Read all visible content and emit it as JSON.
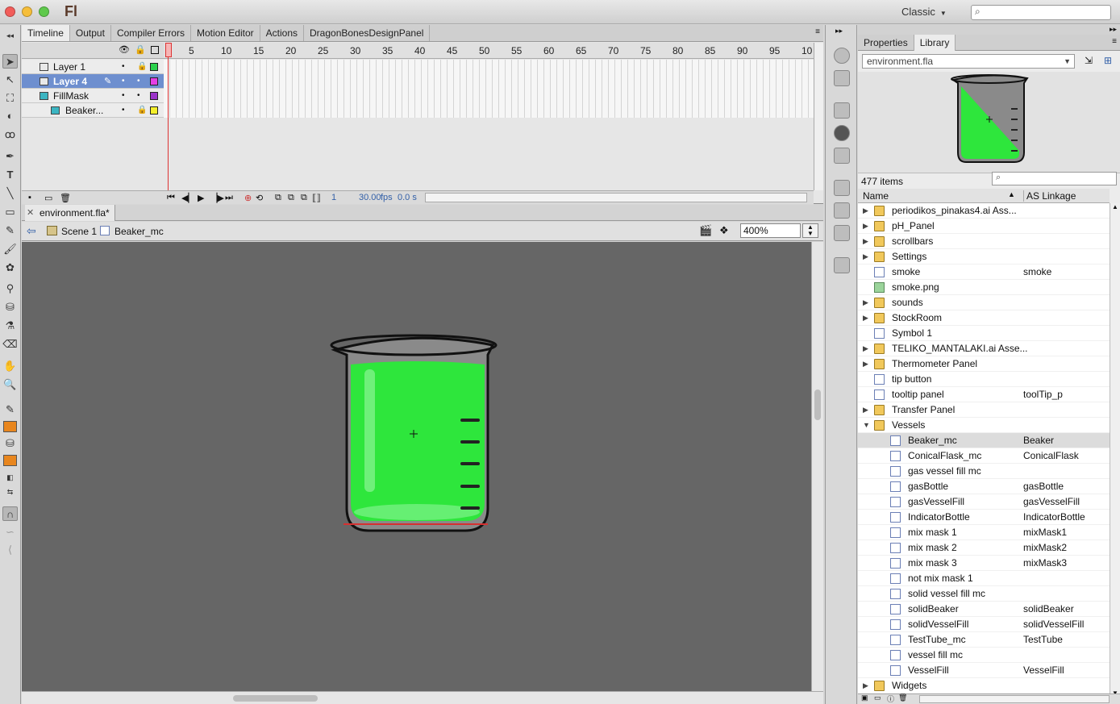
{
  "app": {
    "logo": "Fl",
    "workspace": "Classic"
  },
  "timeline_tabs": [
    "Timeline",
    "Output",
    "Compiler Errors",
    "Motion Editor",
    "Actions",
    "DragonBonesDesignPanel"
  ],
  "layers": [
    {
      "name": "Layer 1",
      "color": "#2bd14c",
      "selected": false,
      "type": "layer"
    },
    {
      "name": "Layer 4",
      "color": "#e43fe5",
      "selected": true,
      "type": "layer"
    },
    {
      "name": "FillMask",
      "color": "#9b33c9",
      "selected": false,
      "type": "mask"
    },
    {
      "name": "Beaker...",
      "color": "#f4ef2b",
      "selected": false,
      "type": "masked"
    }
  ],
  "frame_numbers": [
    "1",
    "5",
    "10",
    "15",
    "20",
    "25",
    "30",
    "35",
    "40",
    "45",
    "50",
    "55",
    "60",
    "65",
    "70",
    "75",
    "80",
    "85",
    "90",
    "95",
    "10"
  ],
  "timeline_footer": {
    "frame": "1",
    "fps": "30.00",
    "fps_unit": "fps",
    "time": "0.0 s"
  },
  "document": {
    "tab": "environment.fla*",
    "scene": "Scene 1",
    "symbol": "Beaker_mc",
    "zoom": "400%"
  },
  "library": {
    "tabs": [
      "Properties",
      "Library"
    ],
    "document": "environment.fla",
    "count": "477 items",
    "columns": {
      "name": "Name",
      "linkage": "AS Linkage"
    },
    "items": [
      {
        "name": "periodikos_pinakas4.ai Ass...",
        "linkage": "",
        "icon": "folder",
        "indent": 0,
        "expand": "closed"
      },
      {
        "name": "pH_Panel",
        "linkage": "",
        "icon": "folder",
        "indent": 0,
        "expand": "closed"
      },
      {
        "name": "scrollbars",
        "linkage": "",
        "icon": "folder",
        "indent": 0,
        "expand": "closed"
      },
      {
        "name": "Settings",
        "linkage": "",
        "icon": "folder",
        "indent": 0,
        "expand": "closed"
      },
      {
        "name": "smoke",
        "linkage": "smoke",
        "icon": "symbol",
        "indent": 0,
        "expand": ""
      },
      {
        "name": "smoke.png",
        "linkage": "",
        "icon": "bitmap",
        "indent": 0,
        "expand": ""
      },
      {
        "name": "sounds",
        "linkage": "",
        "icon": "folder",
        "indent": 0,
        "expand": "closed"
      },
      {
        "name": "StockRoom",
        "linkage": "",
        "icon": "folder",
        "indent": 0,
        "expand": "closed"
      },
      {
        "name": "Symbol 1",
        "linkage": "",
        "icon": "symbol",
        "indent": 0,
        "expand": ""
      },
      {
        "name": "TELIKO_MANTALAKI.ai Asse...",
        "linkage": "",
        "icon": "folder",
        "indent": 0,
        "expand": "closed"
      },
      {
        "name": "Thermometer Panel",
        "linkage": "",
        "icon": "folder",
        "indent": 0,
        "expand": "closed"
      },
      {
        "name": "tip button",
        "linkage": "",
        "icon": "symbol",
        "indent": 0,
        "expand": ""
      },
      {
        "name": "tooltip panel",
        "linkage": "toolTip_p",
        "icon": "symbol",
        "indent": 0,
        "expand": ""
      },
      {
        "name": "Transfer Panel",
        "linkage": "",
        "icon": "folder",
        "indent": 0,
        "expand": "closed"
      },
      {
        "name": "Vessels",
        "linkage": "",
        "icon": "folder",
        "indent": 0,
        "expand": "open"
      },
      {
        "name": "Beaker_mc",
        "linkage": "Beaker",
        "icon": "symbol",
        "indent": 1,
        "expand": "",
        "selected": true
      },
      {
        "name": "ConicalFlask_mc",
        "linkage": "ConicalFlask",
        "icon": "symbol",
        "indent": 1,
        "expand": ""
      },
      {
        "name": "gas vessel fill mc",
        "linkage": "",
        "icon": "symbol",
        "indent": 1,
        "expand": ""
      },
      {
        "name": "gasBottle",
        "linkage": "gasBottle",
        "icon": "symbol",
        "indent": 1,
        "expand": ""
      },
      {
        "name": "gasVesselFill",
        "linkage": "gasVesselFill",
        "icon": "symbol",
        "indent": 1,
        "expand": ""
      },
      {
        "name": "IndicatorBottle",
        "linkage": "IndicatorBottle",
        "icon": "symbol",
        "indent": 1,
        "expand": ""
      },
      {
        "name": "mix mask 1",
        "linkage": "mixMask1",
        "icon": "symbol",
        "indent": 1,
        "expand": ""
      },
      {
        "name": "mix mask 2",
        "linkage": "mixMask2",
        "icon": "symbol",
        "indent": 1,
        "expand": ""
      },
      {
        "name": "mix mask 3",
        "linkage": "mixMask3",
        "icon": "symbol",
        "indent": 1,
        "expand": ""
      },
      {
        "name": "not mix mask 1",
        "linkage": "",
        "icon": "symbol",
        "indent": 1,
        "expand": ""
      },
      {
        "name": "solid vessel fill mc",
        "linkage": "",
        "icon": "symbol",
        "indent": 1,
        "expand": ""
      },
      {
        "name": "solidBeaker",
        "linkage": "solidBeaker",
        "icon": "symbol",
        "indent": 1,
        "expand": ""
      },
      {
        "name": "solidVesselFill",
        "linkage": "solidVesselFill",
        "icon": "symbol",
        "indent": 1,
        "expand": ""
      },
      {
        "name": "TestTube_mc",
        "linkage": "TestTube",
        "icon": "symbol",
        "indent": 1,
        "expand": ""
      },
      {
        "name": "vessel fill mc",
        "linkage": "",
        "icon": "symbol",
        "indent": 1,
        "expand": ""
      },
      {
        "name": "VesselFill",
        "linkage": "VesselFill",
        "icon": "symbol",
        "indent": 1,
        "expand": ""
      },
      {
        "name": "Widgets",
        "linkage": "",
        "icon": "folder",
        "indent": 0,
        "expand": "closed"
      }
    ]
  },
  "colors": {
    "stage_bg": "#666666",
    "fill_green": "#2ee63c",
    "selection_blue": "#6e8fcf",
    "stroke_swatch": "#e8861e"
  }
}
